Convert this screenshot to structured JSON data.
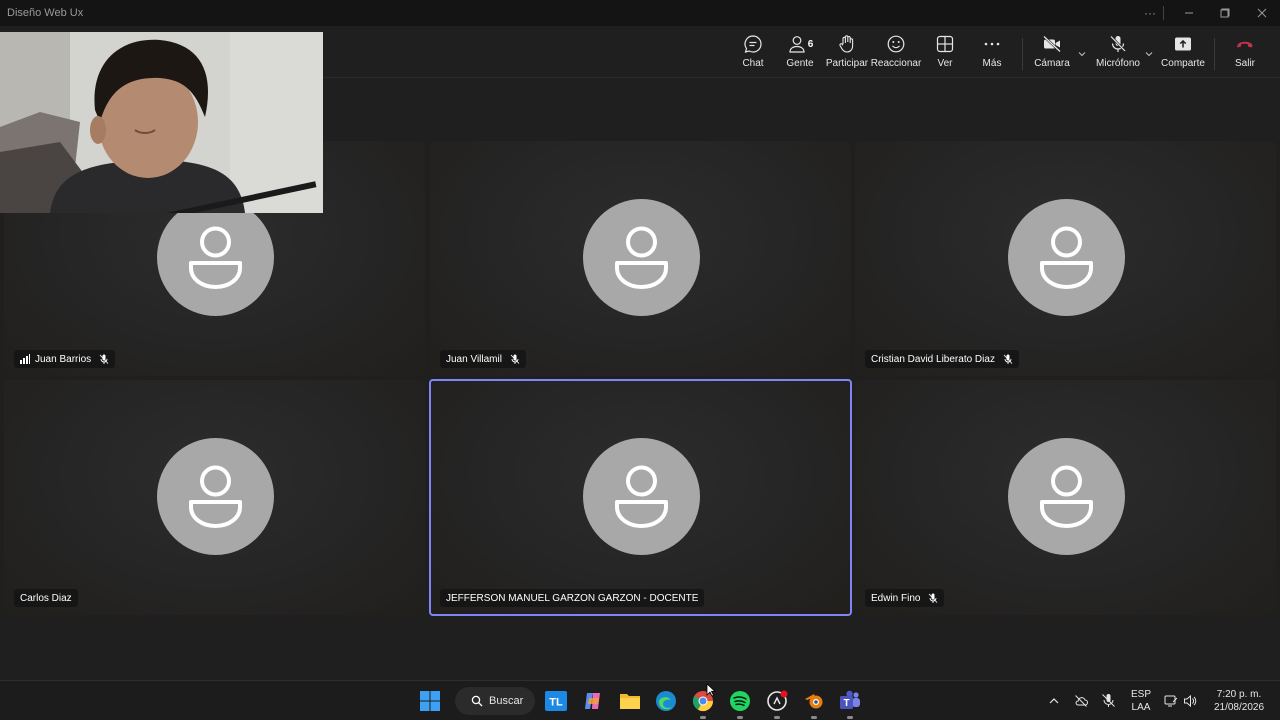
{
  "window": {
    "title": "Diseño Web Ux"
  },
  "toolbar": {
    "chat": "Chat",
    "people": "Gente",
    "people_count": "6",
    "raise_hand": "Participar",
    "react": "Reaccionar",
    "view": "Ver",
    "more": "Más",
    "camera": "Cámara",
    "mic": "Micrófono",
    "share": "Comparte",
    "leave": "Salir",
    "leave_color": "#c4314b"
  },
  "participants": [
    {
      "name": "Juan Barrios",
      "muted": true,
      "signal": true
    },
    {
      "name": "Juan Villamil",
      "muted": true
    },
    {
      "name": "Cristian David Liberato Diaz",
      "muted": true
    },
    {
      "name": "Carlos Diaz",
      "muted": false
    },
    {
      "name": "JEFFERSON MANUEL GARZON GARZON - DOCENTE",
      "muted": false,
      "active_speaker": true
    },
    {
      "name": "Edwin Fino",
      "muted": true
    }
  ],
  "colors": {
    "accent": "#7f85f5",
    "avatar_bg": "#a8a8a8"
  },
  "taskbar": {
    "search_label": "Buscar",
    "lang_top": "ESP",
    "lang_bottom": "LAA",
    "time": "7:20 p. m.",
    "date": "21/08/2026"
  }
}
